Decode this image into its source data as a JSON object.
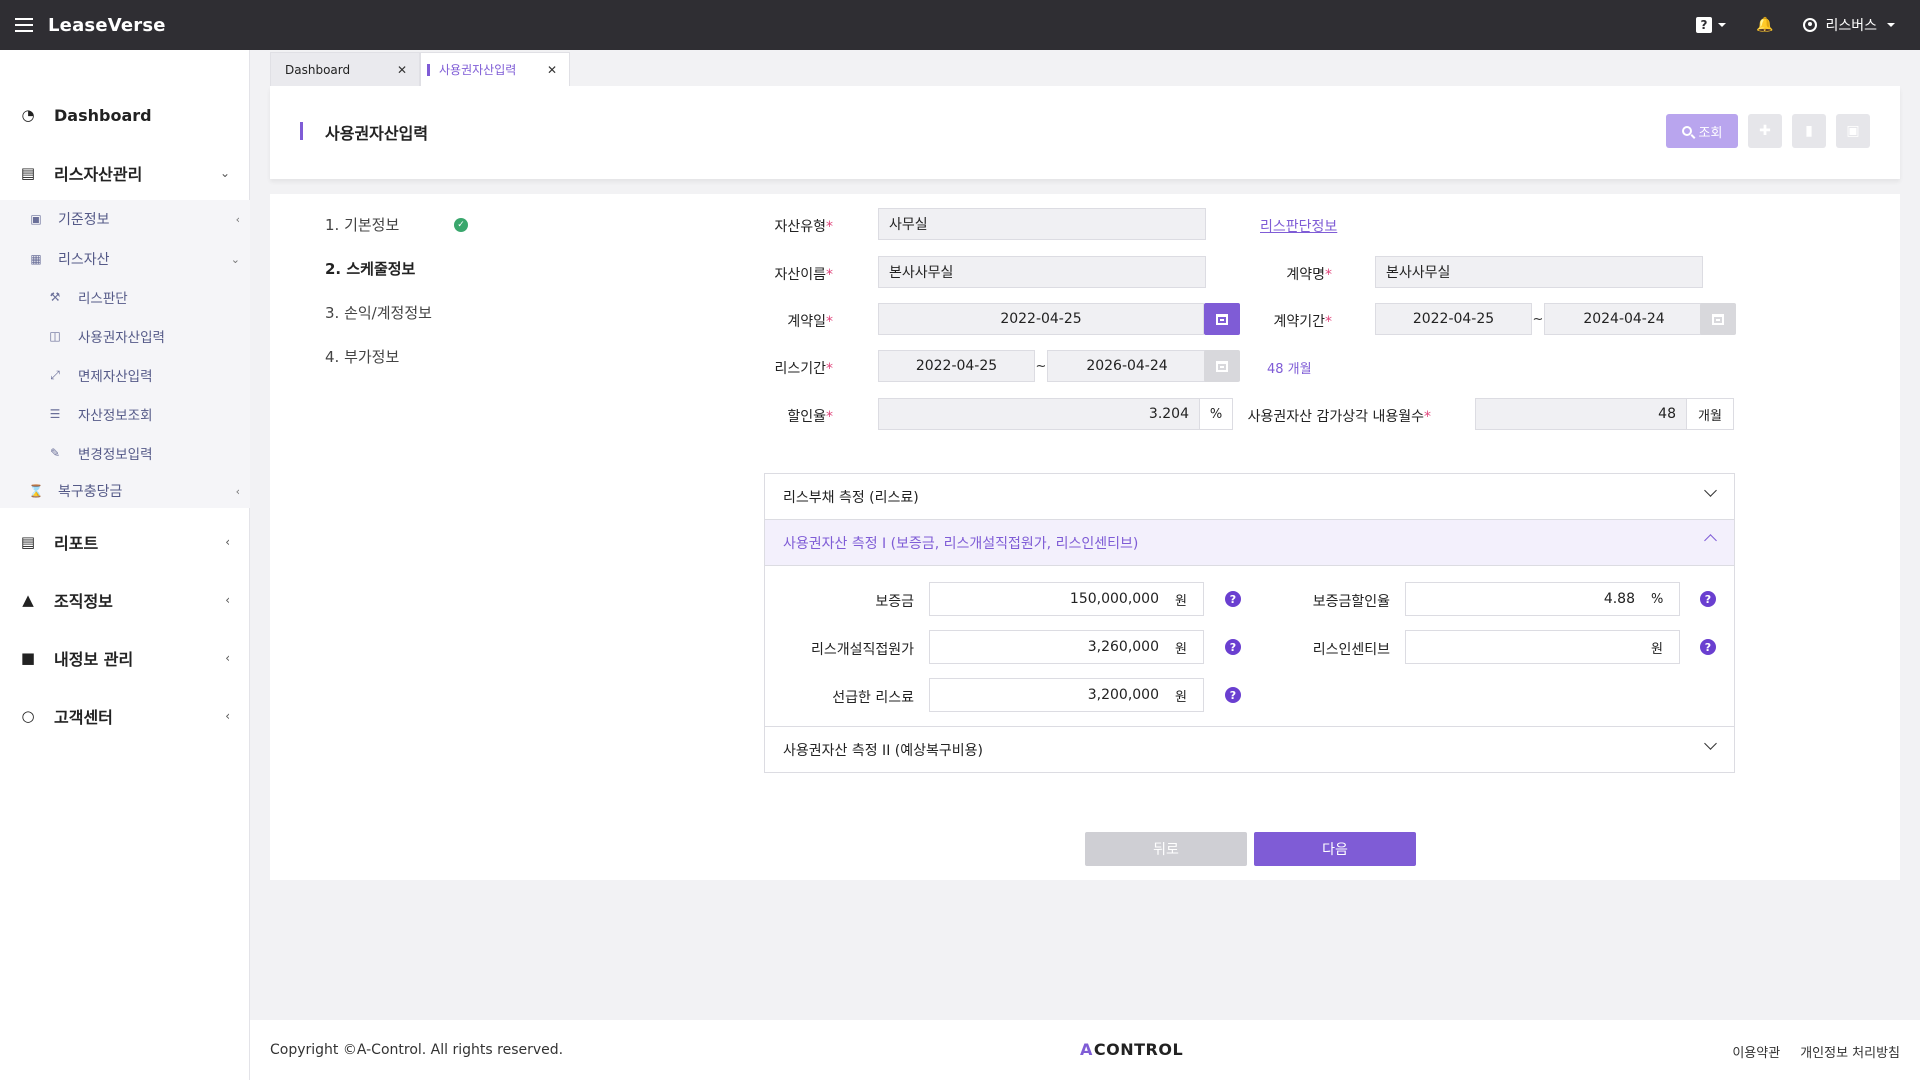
{
  "app": {
    "brand": "LeaseVerse",
    "help_label": "?",
    "user_name": "리스버스"
  },
  "sidebar": {
    "dashboard": "Dashboard",
    "lease_assets": "리스자산관리",
    "base_info": "기준정보",
    "lease_asset": "리스자산",
    "lease_judgment": "리스판단",
    "rou_input": "사용권자산입력",
    "exempt_input": "면제자산입력",
    "asset_query": "자산정보조회",
    "change_input": "변경정보입력",
    "restoration": "복구충당금",
    "report": "리포트",
    "org": "조직정보",
    "my_info": "내정보 관리",
    "support": "고객센터"
  },
  "tabs": [
    {
      "label": "Dashboard",
      "active": false
    },
    {
      "label": "사용권자산입력",
      "active": true
    }
  ],
  "page": {
    "title": "사용권자산입력",
    "search_label": "조회"
  },
  "steps": [
    {
      "label": "1. 기본정보",
      "done": true
    },
    {
      "label": "2. 스케줄정보",
      "current": true
    },
    {
      "label": "3. 손익/계정정보"
    },
    {
      "label": "4. 부가정보"
    }
  ],
  "form": {
    "asset_type_label": "자산유형",
    "asset_type": "사무실",
    "lease_judgment_link": "리스판단정보",
    "asset_name_label": "자산이름",
    "asset_name": "본사사무실",
    "contract_name_label": "계약명",
    "contract_name": "본사사무실",
    "contract_date_label": "계약일",
    "contract_date": "2022-04-25",
    "contract_period_label": "계약기간",
    "contract_start": "2022-04-25",
    "contract_end": "2024-04-24",
    "lease_period_label": "리스기간",
    "lease_start": "2022-04-25",
    "lease_end": "2026-04-24",
    "lease_months": "48 개월",
    "discount_label": "할인율",
    "discount_rate": "3.204",
    "percent_unit": "%",
    "useful_life_label": "사용권자산 감가상각 내용월수",
    "useful_life": "48",
    "month_unit": "개월",
    "tilde": "~"
  },
  "accordion": {
    "section1": "리스부채 측정 (리스료)",
    "section2": "사용권자산 측정 I (보증금, 리스개설직접원가, 리스인센티브)",
    "section3": "사용권자산 측정 II (예상복구비용)",
    "deposit_label": "보증금",
    "deposit": "150,000,000",
    "deposit_discount_label": "보증금할인율",
    "deposit_discount": "4.88",
    "direct_cost_label": "리스개설직접원가",
    "direct_cost": "3,260,000",
    "incentive_label": "리스인센티브",
    "incentive": "",
    "prepaid_label": "선급한 리스료",
    "prepaid": "3,200,000",
    "won": "원",
    "pct": "%"
  },
  "buttons": {
    "back": "뒤로",
    "next": "다음"
  },
  "footer": {
    "copyright": "Copyright ©A-Control. All rights reserved.",
    "logo": "CONTROL",
    "logo_mark": "A",
    "terms": "이용약관",
    "privacy": "개인정보 처리방침"
  }
}
